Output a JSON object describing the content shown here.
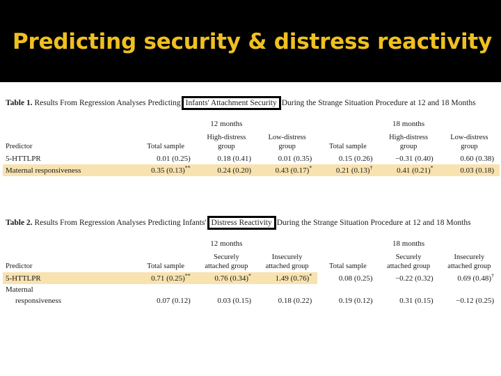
{
  "slide": {
    "title": "Predicting security & distress reactivity",
    "title_color": "#f0c020",
    "band_color": "#000000",
    "highlight_color": "#f7e2b0"
  },
  "table1": {
    "caption_number": "Table 1.",
    "caption_before": " Results From Regression Analyses Predicting",
    "caption_boxed": "Infants' Attachment Security",
    "caption_after": "During the Strange Situation Procedure at 12 and 18 Months",
    "spans": [
      {
        "label": "",
        "cols": 1
      },
      {
        "label": "12 months",
        "cols": 3
      },
      {
        "label": "18 months",
        "cols": 3
      }
    ],
    "span_12": "12 months",
    "span_18": "18 months",
    "headers": [
      "Predictor",
      "Total sample",
      "High-distress group",
      "Low-distress group",
      "Total sample",
      "High-distress group",
      "Low-distress group"
    ],
    "headers_wrapped": [
      {
        "line1": "",
        "line2": "Predictor"
      },
      {
        "line1": "",
        "line2": "Total sample"
      },
      {
        "line1": "High-distress",
        "line2": "group"
      },
      {
        "line1": "Low-distress",
        "line2": "group"
      },
      {
        "line1": "",
        "line2": "Total sample"
      },
      {
        "line1": "High-distress",
        "line2": "group"
      },
      {
        "line1": "Low-distress",
        "line2": "group"
      }
    ],
    "rows": [
      {
        "predictor": "5-HTTLPR",
        "highlight": "none",
        "cells": [
          {
            "value": "0.01 (0.25)",
            "sig": ""
          },
          {
            "value": "0.18 (0.41)",
            "sig": ""
          },
          {
            "value": "0.01 (0.35)",
            "sig": ""
          },
          {
            "value": "0.15 (0.26)",
            "sig": ""
          },
          {
            "value": "−0.31 (0.40)",
            "sig": ""
          },
          {
            "value": "0.60 (0.38)",
            "sig": ""
          }
        ]
      },
      {
        "predictor": "Maternal responsiveness",
        "highlight": "full",
        "cells": [
          {
            "value": "0.35 (0.13)",
            "sig": "**"
          },
          {
            "value": "0.24 (0.20)",
            "sig": ""
          },
          {
            "value": "0.43 (0.17)",
            "sig": "*"
          },
          {
            "value": "0.21 (0.13)",
            "sig": "†"
          },
          {
            "value": "0.41 (0.21)",
            "sig": "*"
          },
          {
            "value": "0.03 (0.18)",
            "sig": ""
          }
        ]
      }
    ]
  },
  "table2": {
    "caption_number": "Table 2.",
    "caption_before": " Results From Regression Analyses Predicting Infants'",
    "caption_boxed": "Distress Reactivity",
    "caption_after": "During the Strange Situation Procedure at 12 and 18 Months",
    "span_12": "12 months",
    "span_18": "18 months",
    "headers_wrapped": [
      {
        "line1": "",
        "line2": "Predictor"
      },
      {
        "line1": "",
        "line2": "Total sample"
      },
      {
        "line1": "Securely",
        "line2": "attached group"
      },
      {
        "line1": "Insecurely",
        "line2": "attached group"
      },
      {
        "line1": "",
        "line2": "Total sample"
      },
      {
        "line1": "Securely",
        "line2": "attached group"
      },
      {
        "line1": "Insecurely",
        "line2": "attached group"
      }
    ],
    "rows": [
      {
        "predictor": "5-HTTLPR",
        "highlight": "partial",
        "highlight_cells": 3,
        "cells": [
          {
            "value": "0.71 (0.25)",
            "sig": "**"
          },
          {
            "value": "0.76 (0.34)",
            "sig": "*"
          },
          {
            "value": "1.49 (0.76)",
            "sig": "*"
          },
          {
            "value": "0.08 (0.25)",
            "sig": ""
          },
          {
            "value": "−0.22 (0.32)",
            "sig": ""
          },
          {
            "value": "0.69 (0.48)",
            "sig": "†"
          }
        ]
      },
      {
        "predictor_line1": "Maternal",
        "predictor_line2": "responsiveness",
        "predictor": "Maternal responsiveness",
        "highlight": "none",
        "cells": [
          {
            "value": "0.07 (0.12)",
            "sig": ""
          },
          {
            "value": "0.03 (0.15)",
            "sig": ""
          },
          {
            "value": "0.18 (0.22)",
            "sig": ""
          },
          {
            "value": "0.19 (0.12)",
            "sig": ""
          },
          {
            "value": "0.31 (0.15)",
            "sig": ""
          },
          {
            "value": "−0.12 (0.25)",
            "sig": ""
          }
        ]
      }
    ]
  }
}
